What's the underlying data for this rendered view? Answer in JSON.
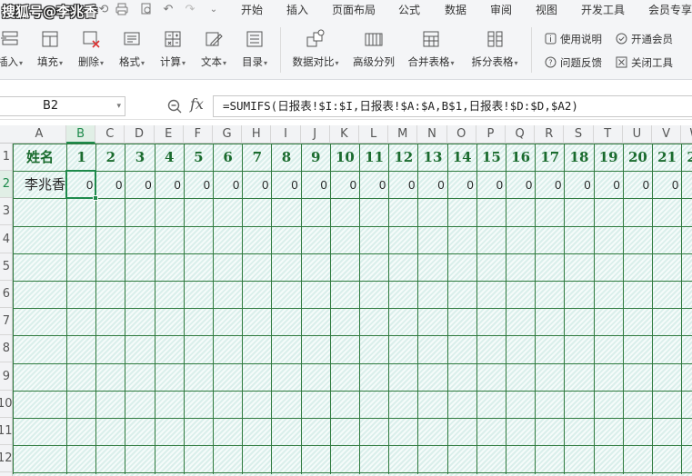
{
  "watermark": "搜狐号@李兆香",
  "menubar": {
    "tabs": [
      "开始",
      "插入",
      "页面布局",
      "公式",
      "数据",
      "审阅",
      "视图",
      "开发工具",
      "会员专享"
    ]
  },
  "ribbon": {
    "group1": [
      "插入",
      "填充",
      "删除",
      "格式",
      "计算",
      "文本",
      "目录"
    ],
    "group2": [
      "数据对比",
      "高级分列",
      "合并表格",
      "拆分表格"
    ],
    "side": [
      "使用说明",
      "开通会员",
      "问题反馈",
      "关闭工具"
    ]
  },
  "formula_bar": {
    "name_box": "B2",
    "fx_label": "fx",
    "formula": "=SUMIFS(日报表!$I:$I,日报表!$A:$A,B$1,日报表!$D:$D,$A2)"
  },
  "sheet": {
    "columns": [
      "A",
      "B",
      "C",
      "D",
      "E",
      "F",
      "G",
      "H",
      "I",
      "J",
      "K",
      "L",
      "M",
      "N",
      "O",
      "P",
      "Q",
      "R",
      "S",
      "T",
      "U",
      "V",
      "W"
    ],
    "rows": [
      "1",
      "2",
      "3",
      "4",
      "5",
      "6",
      "7",
      "8",
      "9",
      "10",
      "11",
      "12"
    ],
    "selected_cell": "B2",
    "header_row": [
      "姓名",
      "1",
      "2",
      "3",
      "4",
      "5",
      "6",
      "7",
      "8",
      "9",
      "10",
      "11",
      "12",
      "13",
      "14",
      "15",
      "16",
      "17",
      "18",
      "19",
      "20",
      "21",
      "22"
    ],
    "data_row": [
      "李兆香",
      "0",
      "0",
      "0",
      "0",
      "0",
      "0",
      "0",
      "0",
      "0",
      "0",
      "0",
      "0",
      "0",
      "0",
      "0",
      "0",
      "0",
      "0",
      "0",
      "0",
      "0",
      "0"
    ]
  },
  "colors": {
    "grid_line": "#2f7a3e",
    "header_text": "#1a6b2e",
    "selection": "#1e8a4b",
    "cell_fill": "#e9f6f3"
  }
}
